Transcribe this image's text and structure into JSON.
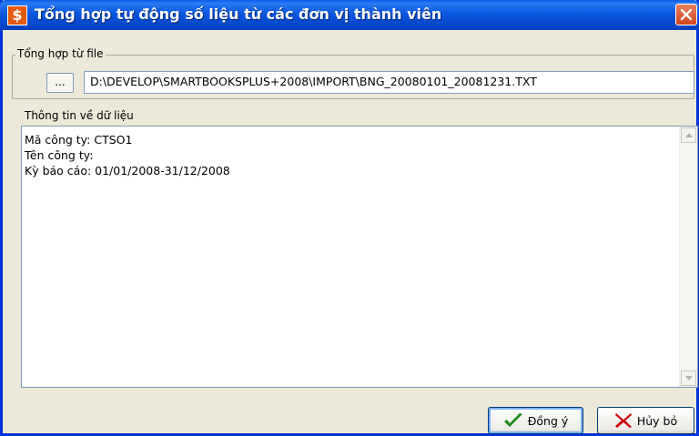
{
  "window": {
    "title": "Tổng hợp tự động số liệu từ các đơn vị thành viên",
    "icon": "dollar-icon",
    "close_icon": "close-icon"
  },
  "file_group": {
    "label": "Tổng hợp từ file",
    "browse_label": "...",
    "path_value": "D:\\DEVELOP\\SMARTBOOKSPLUS+2008\\IMPORT\\BNG_20080101_20081231.TXT"
  },
  "info_group": {
    "label": "Thông tin về dữ liệu",
    "lines": [
      "Mã công ty: CTSO1",
      "Tên công ty:",
      "Kỳ báo cáo: 01/01/2008-31/12/2008"
    ]
  },
  "buttons": {
    "ok_label": "Đồng ý",
    "ok_icon": "checkmark-icon",
    "cancel_label": "Hủy bỏ",
    "cancel_icon": "x-mark-icon"
  },
  "colors": {
    "titlebar": "#0a58df",
    "face": "#ece9d8",
    "ok_check": "#1a8c1a",
    "cancel_x": "#cc0000"
  }
}
